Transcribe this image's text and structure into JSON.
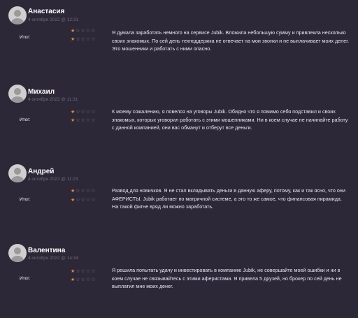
{
  "rating_label": "Итог:",
  "reviews": [
    {
      "name": "Анастасия",
      "date": "4 октября 2022 @ 12:31",
      "rating_1": 1,
      "rating_2": 1,
      "text": "Я думала заработать немного на сервисе Jubik. Вложила небольшую сумму и привлекла несколько своих знакомых. По сей день техподдержка не отвечает на мои звонки и не выплачивает моих денег. Это мошенники и работать с ними опасно."
    },
    {
      "name": "Михаил",
      "date": "4 октября 2022 @ 11:31",
      "rating_1": 1,
      "rating_2": 1,
      "text": "К моему сожалению, я повелся на уговоры Jubik. Обидно что я помимо себя подставил и своих знакомых, которых уговорил работать с этими мошенниками. Ни в коем случае не начинайте работу с данной компанией, они вас обманут и отберут все деньги."
    },
    {
      "name": "Андрей",
      "date": "4 октября 2022 @ 11:23",
      "rating_1": 1,
      "rating_2": 1,
      "text": "Развод для новичков. Я не стал вкладывать деньги в данную аферу, потому, как и так ясно, что они АФЕРИСТЫ. Jubik работает по матричной системе, а это то же самое, что финансовая пирамида. На такой фигне вряд ли можно заработать."
    },
    {
      "name": "Валентина",
      "date": "4 октября 2022 @ 14:34",
      "rating_1": 1,
      "rating_2": 1,
      "text": "Я решила попытать удачу и инвестировать в компанию Jubik, не совершайте моей ошибки и ни в коем случае не связывайтесь с этими аферистами. Я привела 5 друзей, но брокер по сей день не выплатил мне моих денег."
    }
  ]
}
